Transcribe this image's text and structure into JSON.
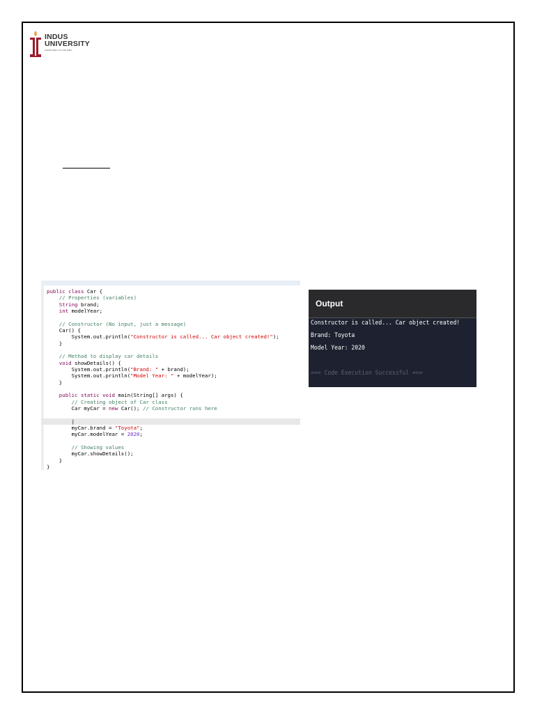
{
  "logo": {
    "line1": "INDUS",
    "line2": "UNIVERSITY",
    "tagline": "LEARN WELL TO LIVE WELL"
  },
  "code": {
    "lines": [
      [
        [
          "public class ",
          "kw"
        ],
        [
          "Car {",
          "tx"
        ]
      ],
      [
        [
          "    // Properties (variables)",
          "cm"
        ]
      ],
      [
        [
          "    String ",
          "kw"
        ],
        [
          "brand;",
          "tx"
        ]
      ],
      [
        [
          "    int ",
          "kw"
        ],
        [
          "modelYear;",
          "tx"
        ]
      ],
      [],
      [
        [
          "    // Constructor (No input, just a message)",
          "cm"
        ]
      ],
      [
        [
          "    Car() {",
          "tx"
        ]
      ],
      [
        [
          "        System.out.println(",
          "tx"
        ],
        [
          "\"Constructor is called... Car object created!\"",
          "st"
        ],
        [
          ");",
          "tx"
        ]
      ],
      [
        [
          "    }",
          "tx"
        ]
      ],
      [],
      [
        [
          "    // Method to display car details",
          "cm"
        ]
      ],
      [
        [
          "    void ",
          "kw"
        ],
        [
          "showDetails() {",
          "tx"
        ]
      ],
      [
        [
          "        System.out.println(",
          "tx"
        ],
        [
          "\"Brand: \"",
          "st"
        ],
        [
          " + brand);",
          "tx"
        ]
      ],
      [
        [
          "        System.out.println(",
          "tx"
        ],
        [
          "\"Model Year: \"",
          "st"
        ],
        [
          " + modelYear);",
          "tx"
        ]
      ],
      [
        [
          "    }",
          "tx"
        ]
      ],
      [],
      [
        [
          "    public static void ",
          "kw"
        ],
        [
          "main(String[] args) {",
          "tx"
        ]
      ],
      [
        [
          "        // Creating object of Car class",
          "cm"
        ]
      ],
      [
        [
          "        Car myCar = ",
          "tx"
        ],
        [
          "new ",
          "kw"
        ],
        [
          "Car(); ",
          "tx"
        ],
        [
          "// Constructor runs here",
          "cm"
        ]
      ],
      [],
      [
        [
          "        |",
          "tx"
        ]
      ],
      [
        [
          "        myCar.brand = ",
          "tx"
        ],
        [
          "\"Toyota\"",
          "st"
        ],
        [
          ";",
          "tx"
        ]
      ],
      [
        [
          "        myCar.modelYear = ",
          "tx"
        ],
        [
          "2020",
          "nm"
        ],
        [
          ";",
          "tx"
        ]
      ],
      [],
      [
        [
          "        // Showing values",
          "cm"
        ]
      ],
      [
        [
          "        myCar.showDetails();",
          "tx"
        ]
      ],
      [
        [
          "    }",
          "tx"
        ]
      ],
      [
        [
          "}",
          "tx"
        ]
      ]
    ]
  },
  "output": {
    "title": "Output",
    "lines": [
      "Constructor is called... Car object created!",
      "Brand: Toyota",
      "Model Year: 2020",
      "",
      "=== Code Execution Successful ==="
    ]
  }
}
